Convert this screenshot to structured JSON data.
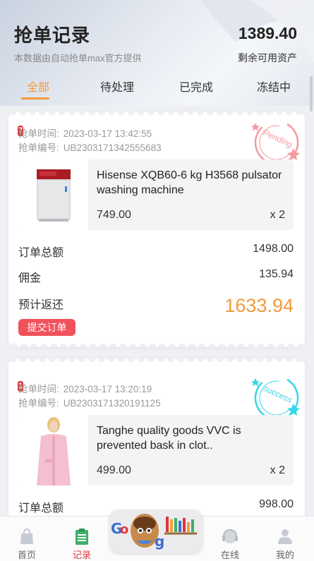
{
  "header": {
    "title": "抢单记录",
    "subtitle": "本数据由自动抢单max官方提供",
    "balance": "1389.40",
    "balance_label": "剩余可用资产"
  },
  "tabs": [
    {
      "label": "全部",
      "active": true
    },
    {
      "label": "待处理",
      "active": false
    },
    {
      "label": "已完成",
      "active": false
    },
    {
      "label": "冻结中",
      "active": false
    }
  ],
  "orders": [
    {
      "badge": "7",
      "time_label": "抢单时间:",
      "time": "2023-03-17 13:42:55",
      "id_label": "抢单编号:",
      "id": "UB2303171342555683",
      "status_stamp": "Pending",
      "product_name": "Hisense XQB60-6 kg H3568 pulsator washing machine",
      "price": "749.00",
      "qty": "x 2",
      "total_label": "订单总额",
      "total": "1498.00",
      "commission_label": "佣金",
      "commission": "135.94",
      "return_label": "预计返还",
      "return": "1633.94",
      "submit_label": "提交订单"
    },
    {
      "badge": "1",
      "time_label": "抢单时间:",
      "time": "2023-03-17 13:20:19",
      "id_label": "抢单编号:",
      "id": "UB2303171320191125",
      "status_stamp": "success",
      "product_name": "Tanghe quality goods VVC is prevented bask in clot..",
      "price": "499.00",
      "qty": "x 2",
      "total_label": "订单总额",
      "total": "998.00"
    }
  ],
  "bottom_nav": [
    {
      "label": "首页",
      "icon": "bag-icon",
      "active": false
    },
    {
      "label": "记录",
      "icon": "clipboard-icon",
      "active": true
    },
    {
      "label": "在线",
      "icon": "headset-icon",
      "active": false
    },
    {
      "label": "我的",
      "icon": "user-icon",
      "active": false
    }
  ],
  "colors": {
    "accent": "#f29a3a",
    "danger": "#e0353b",
    "button": "#f0525c",
    "pending_stamp": "#f39aa0",
    "success_stamp": "#35d8e8"
  }
}
